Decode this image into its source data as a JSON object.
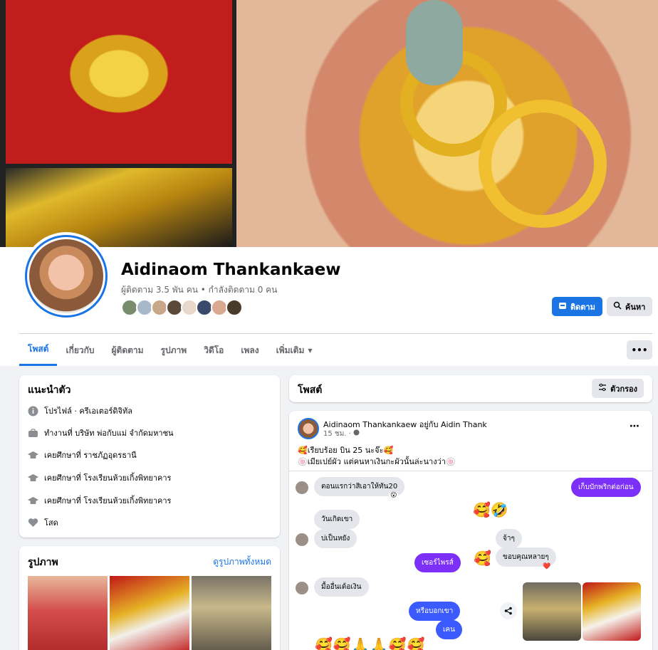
{
  "profile": {
    "name": "Aidinaom Thankankaew",
    "subline": "ผู้ติดตาม 3.5 พัน คน • กำลังติดตาม 0 คน",
    "follow_label": "ติดตาม",
    "search_label": "ค้นหา"
  },
  "tabs": [
    "โพสต์",
    "เกี่ยวกับ",
    "ผู้ติดตาม",
    "รูปภาพ",
    "วิดีโอ",
    "เพลง",
    "เพิ่มเติม"
  ],
  "more_label": "•••",
  "intro": {
    "title": "แนะนำตัว",
    "rows": [
      {
        "icon": "info-icon",
        "text": "โปรไฟล์ · ครีเอเตอร์ดิจิทัล"
      },
      {
        "icon": "briefcase-icon",
        "text": "ทำงานที่ บริษัท พ่อกับแม่ จำกัดมหาชน"
      },
      {
        "icon": "graduation-cap-icon",
        "text": "เคยศึกษาที่ ราชภัฏอุดรธานี"
      },
      {
        "icon": "graduation-cap-icon",
        "text": "เคยศึกษาที่ โรงเรียนห้วยเกิ้งพิทยาคาร"
      },
      {
        "icon": "graduation-cap-icon",
        "text": "เคยศึกษาที่ โรงเรียนห้วยเกิ้งพิทยาคาร"
      },
      {
        "icon": "heart-icon",
        "text": "โสด"
      }
    ]
  },
  "photos": {
    "title": "รูปภาพ",
    "see_all": "ดูรูปภาพทั้งหมด"
  },
  "posts_header": {
    "title": "โพสต์",
    "filter_label": "ตัวกรอง"
  },
  "post": {
    "author": "Aidinaom Thankankaew",
    "with_text": "อยู่กับ Aidin Thank",
    "time": "15 ชม. ·",
    "line1": "🥰เรียบร้อย บิน 25 นะจ๊ะ🥰",
    "line2": "🍥เมียเปย์ผัว แต่คนหาเงินกะผัวนั้นล่ะนางว่า🍥"
  },
  "chat": {
    "msg1": "ตอนแรกว่าสิเอาให้ทัน20",
    "msg1_reaction": "😮",
    "msg_right1": "เก็บบักพริกต่อก่อน",
    "msg2": "วันเกิดเขา",
    "msg3": "บ่เป็นหยัง",
    "msg_reply1": "จ้าๆ",
    "msg_reply2": "ขอบคุณหลายๆ",
    "msg_reply2_reaction": "❤️",
    "msg_right2": "เซอร์ไพรส์",
    "msg4": "มื้ออื่นเด้อเงิน",
    "msg_right3": "หรือบอกเขา",
    "msg_right4": "เคน",
    "emoji_row1": "🥰🤣",
    "emoji_reply": "🥰",
    "emoji_row2": "🥰🥰🙏🙏🥰🥰",
    "share_icon": "share-icon"
  }
}
